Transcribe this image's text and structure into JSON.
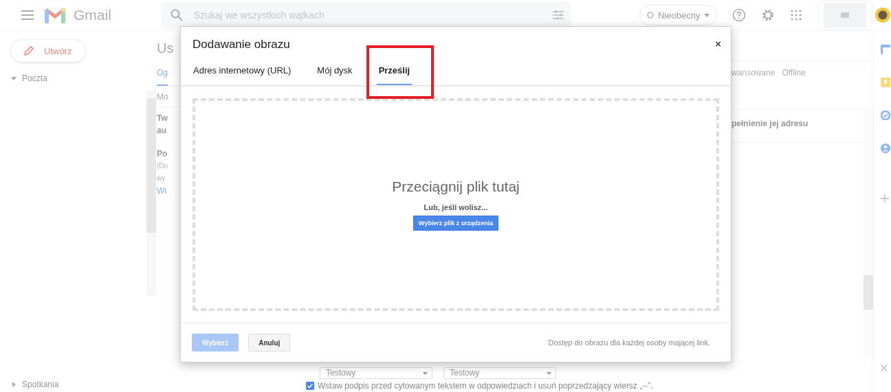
{
  "header": {
    "app_name": "Gmail",
    "search": {
      "placeholder": "Szukaj we wszystkich wątkach"
    },
    "status": {
      "label": "Nieobecny"
    }
  },
  "sidebar": {
    "compose": "Utwórz",
    "sections": [
      {
        "label": "Poczta",
        "expanded": true
      },
      {
        "label": "Spotkania",
        "expanded": false
      }
    ]
  },
  "settings": {
    "title": "Us",
    "tabs": [
      {
        "label": "Og",
        "selected": true
      }
    ],
    "tabs_right": [
      {
        "label": "wansowane",
        "selected": false
      },
      {
        "label": "Offline",
        "selected": false
      }
    ],
    "subtab": "Mo",
    "left_fragments": [
      {
        "text": "Tw",
        "kind": "heading"
      },
      {
        "text": "au",
        "kind": "heading"
      },
      {
        "text": "Po",
        "kind": "heading"
      },
      {
        "text": "(Do",
        "kind": "note"
      },
      {
        "text": "wy",
        "kind": "note"
      },
      {
        "text": "Wi",
        "kind": "link"
      }
    ],
    "right_fragments": [
      {
        "text": "pełnienie jej adresu",
        "kind": "heading"
      }
    ],
    "dropdowns": [
      "Testowy",
      "Testowy"
    ],
    "signature_option": {
      "label": "Wstaw podpis przed cytowanym tekstem w odpowiedziach i usuń poprzedzający wiersz „--”.",
      "checked": true
    }
  },
  "dialog": {
    "title": "Dodawanie obrazu",
    "close": "×",
    "tabs": [
      {
        "label": "Adres internetowy (URL)",
        "selected": false,
        "highlighted": false
      },
      {
        "label": "Mój dysk",
        "selected": false,
        "highlighted": false
      },
      {
        "label": "Prześlij",
        "selected": true,
        "highlighted": true
      }
    ],
    "drop_zone": {
      "heading": "Przeciągnij plik tutaj",
      "subtext": "Lub, jeśli wolisz...",
      "button": "Wybierz plik z urządzenia"
    },
    "buttons": [
      {
        "label": "Wybierz",
        "kind": "primary",
        "disabled": true
      },
      {
        "label": "Anuluj",
        "kind": "secondary",
        "disabled": false
      }
    ],
    "note": "Dostęp do obrazu dla każdej osoby mającej link."
  }
}
